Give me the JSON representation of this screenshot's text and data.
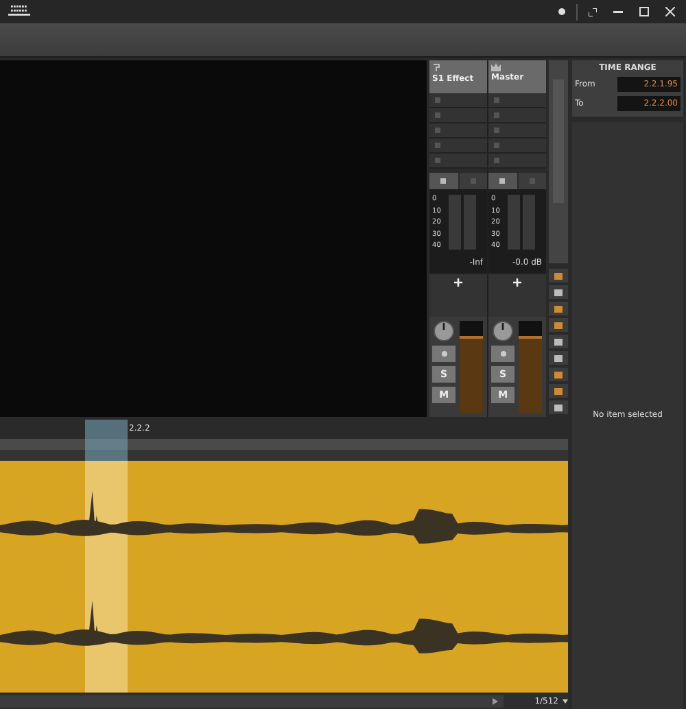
{
  "mixer": {
    "channels": [
      {
        "kind": "effect",
        "name": "S1 Effect",
        "scale": [
          "0",
          "10",
          "20",
          "30",
          "40"
        ],
        "readout": "-Inf",
        "solo": "S",
        "mute": "M",
        "fader": {
          "level": 0.8
        }
      },
      {
        "kind": "master",
        "name": "Master",
        "scale": [
          "0",
          "10",
          "20",
          "30",
          "40"
        ],
        "readout": "-0.0 dB",
        "solo": "S",
        "mute": "M",
        "fader": {
          "level": 0.8
        }
      }
    ]
  },
  "time_range": {
    "title": "TIME RANGE",
    "from_label": "From",
    "from_value": "2.2.1.95",
    "to_label": "To",
    "to_value": "2.2.2.00"
  },
  "inspector": {
    "message": "No item selected"
  },
  "timeline": {
    "marker": "2.2.2"
  },
  "bottom_bar": {
    "grid": "1/512"
  }
}
